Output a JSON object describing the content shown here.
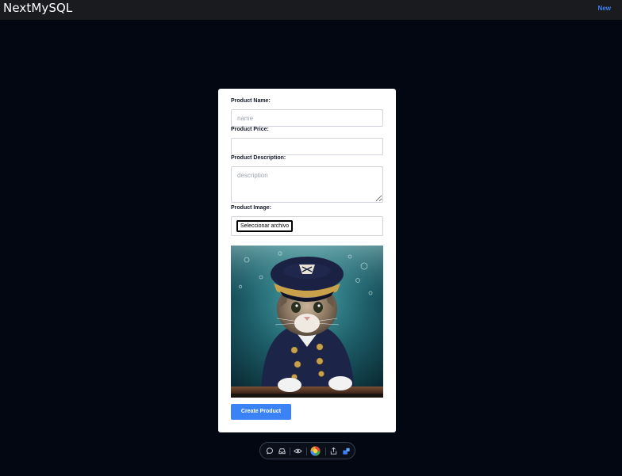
{
  "navbar": {
    "brand": "NextMySQL",
    "new_link": "New"
  },
  "form": {
    "name_label": "Product Name:",
    "name_placeholder": "name",
    "name_value": "",
    "price_label": "Product Price:",
    "price_value": "",
    "description_label": "Product Description:",
    "description_placeholder": "description",
    "description_value": "",
    "image_label": "Product Image:",
    "file_button": "Seleccionar archivo",
    "submit": "Create Product"
  },
  "toolbar": {
    "icons": [
      "chat-icon",
      "inbox-icon",
      "eye-icon",
      "color-wheel-icon",
      "share-icon",
      "extension-icon"
    ]
  },
  "colors": {
    "page_background": "#030712",
    "navbar_background": "#1a1b1f",
    "accent": "#3b82f6"
  }
}
